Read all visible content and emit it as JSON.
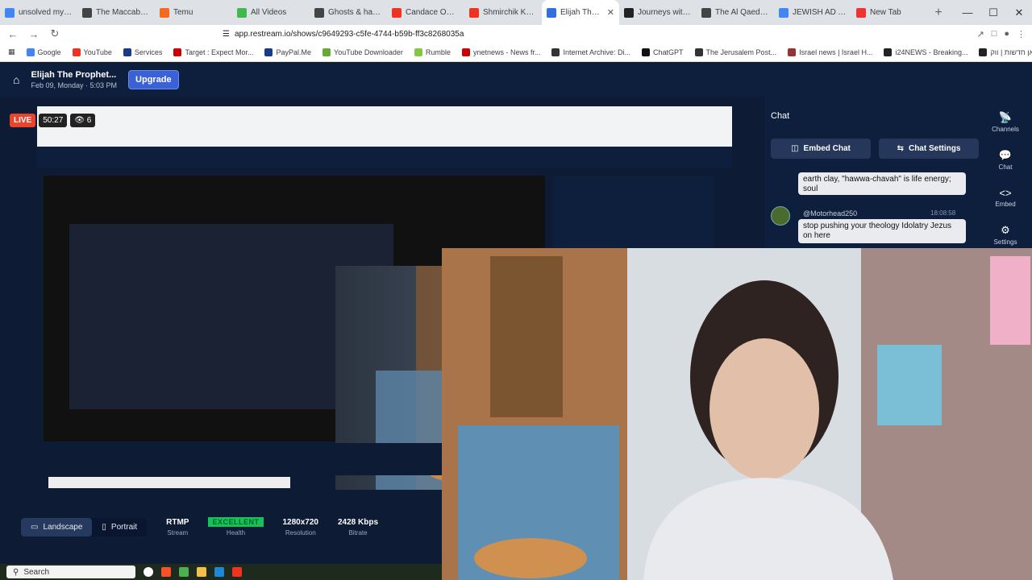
{
  "tabs": [
    {
      "title": "unsolved myster",
      "color": "#4285f4"
    },
    {
      "title": "The Maccabees",
      "color": "#444"
    },
    {
      "title": "Temu",
      "color": "#f56a1f"
    },
    {
      "title": "All Videos",
      "color": "#3fb950"
    },
    {
      "title": "Ghosts & hauntin",
      "color": "#444"
    },
    {
      "title": "Candace Owens",
      "color": "#e32"
    },
    {
      "title": "Shmirchik Kvetch",
      "color": "#e32"
    },
    {
      "title": "Elijah The Pr",
      "color": "#2f6fe0",
      "active": true
    },
    {
      "title": "Journeys with Eli",
      "color": "#222"
    },
    {
      "title": "The Al Qaeda Co",
      "color": "#444"
    },
    {
      "title": "JEWISH AD AT T",
      "color": "#4285f4"
    },
    {
      "title": "New Tab",
      "color": "#e33"
    }
  ],
  "address": "app.restream.io/shows/c9649293-c5fe-4744-b59b-ff3c8268035a",
  "bookmarks": [
    {
      "label": "Google",
      "color": "#4285f4"
    },
    {
      "label": "YouTube",
      "color": "#e32"
    },
    {
      "label": "Services",
      "color": "#1a3a8a"
    },
    {
      "label": "Target : Expect Mor...",
      "color": "#cc0000"
    },
    {
      "label": "PayPal.Me",
      "color": "#1a3a8a"
    },
    {
      "label": "YouTube Downloader",
      "color": "#6a3"
    },
    {
      "label": "Rumble",
      "color": "#85c742"
    },
    {
      "label": "ynetnews - News fr...",
      "color": "#c00"
    },
    {
      "label": "Internet Archive: Di...",
      "color": "#333"
    },
    {
      "label": "ChatGPT",
      "color": "#111"
    },
    {
      "label": "The Jerusalem Post...",
      "color": "#333"
    },
    {
      "label": "Israel news | Israel H...",
      "color": "#933"
    },
    {
      "label": "i24NEWS - Breaking...",
      "color": "#222"
    },
    {
      "label": "כאן חדשות | ווק...",
      "color": "#222"
    }
  ],
  "show": {
    "title": "Elijah The Prophet...",
    "date": "Feb 09, Monday · 5:03 PM",
    "upgrade_label": "Upgrade"
  },
  "live": {
    "label": "LIVE",
    "timer": "50:27",
    "viewers": "6"
  },
  "stream_modes": {
    "landscape": "Landscape",
    "portrait": "Portrait"
  },
  "stats": {
    "protocol": {
      "value": "RTMP",
      "label": "Stream"
    },
    "health": {
      "value": "EXCELLENT",
      "label": "Health"
    },
    "resolution": {
      "value": "1280x720",
      "label": "Resolution"
    },
    "bitrate": {
      "value": "2428 Kbps",
      "label": "Bitrate"
    }
  },
  "chat": {
    "title": "Chat",
    "embed_label": "Embed Chat",
    "settings_label": "Chat Settings",
    "prev_message": "earth clay, \"hawwa-chavah\" is life energy; soul",
    "message": {
      "user": "@Motorhead250",
      "time": "18:08:58",
      "text": "stop pushing your theology Idolatry Jezus on here"
    }
  },
  "rail": [
    {
      "label": "Channels",
      "icon": "📡"
    },
    {
      "label": "Chat",
      "icon": "💬"
    },
    {
      "label": "Embed",
      "icon": "<>"
    },
    {
      "label": "Settings",
      "icon": "⚙"
    }
  ],
  "taskbar": {
    "search": "Search"
  }
}
